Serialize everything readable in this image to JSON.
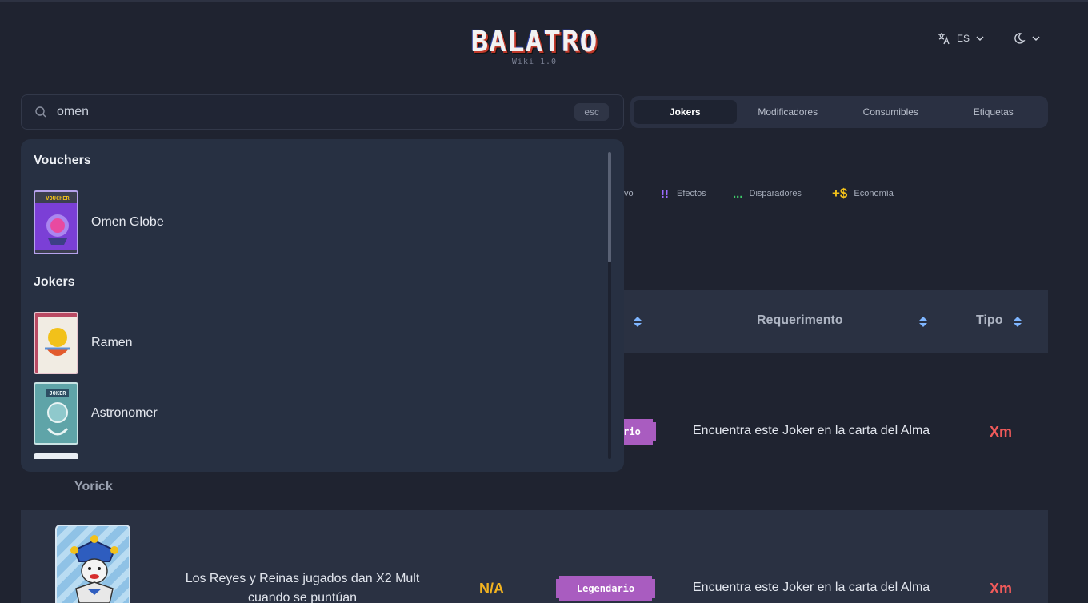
{
  "header": {
    "logo_text": "BALATRO",
    "logo_sub": "Wiki 1.0",
    "language": "ES",
    "icons": {
      "language": "translate-icon",
      "theme": "moon-icon",
      "dropdown": "chevron-down-icon"
    }
  },
  "search": {
    "value": "omen",
    "esc_label": "esc",
    "icon": "search-icon"
  },
  "tabs": [
    {
      "label": "Jokers",
      "active": true
    },
    {
      "label": "Modificadores",
      "active": false
    },
    {
      "label": "Consumibles",
      "active": false
    },
    {
      "label": "Etiquetas",
      "active": false
    }
  ],
  "legend": {
    "fragment": "vo",
    "effects": {
      "icon_text": "!!",
      "label": "Efectos",
      "color": "#9b6bff"
    },
    "triggers": {
      "icon_text": "...",
      "label": "Disparadores",
      "color": "#3ecf6a"
    },
    "economy": {
      "icon_text": "+$",
      "label": "Economía",
      "color": "#f2c11a"
    }
  },
  "table": {
    "headers": {
      "requirement": "Requerimento",
      "type": "Tipo"
    },
    "row1": {
      "rarity_fragment": "rio",
      "requirement": "Encuentra este Joker en la carta del Alma",
      "type": "Xm"
    },
    "row1_name": "Yorick",
    "row2": {
      "effect": "Los Reyes y Reinas jugados dan X2 Mult cuando se puntúan",
      "cost": "N/A",
      "rarity": "Legendario",
      "requirement": "Encuentra este Joker en la carta del Alma",
      "type": "Xm"
    }
  },
  "dropdown": {
    "groups": [
      {
        "title": "Vouchers",
        "items": [
          {
            "label": "Omen Globe"
          }
        ]
      },
      {
        "title": "Jokers",
        "items": [
          {
            "label": "Ramen"
          },
          {
            "label": "Astronomer"
          }
        ]
      }
    ],
    "thumb_texts": {
      "voucher": "VOUCHER",
      "joker": "JOKER"
    }
  },
  "colors": {
    "background": "#1f2330",
    "panel": "#273042",
    "legendary": "#a95cc0",
    "type_red": "#f05a5a",
    "cost_gold": "#f2b320"
  }
}
